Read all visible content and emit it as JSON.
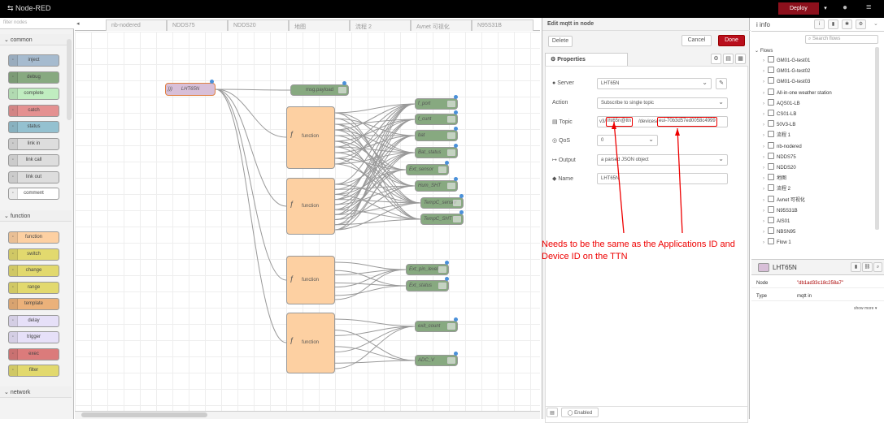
{
  "header": {
    "app_title": "Node-RED",
    "deploy_label": "Deploy"
  },
  "palette": {
    "filter_placeholder": "filter nodes",
    "categories": [
      "common",
      "function",
      "network"
    ],
    "common_nodes": [
      "inject",
      "debug",
      "complete",
      "catch",
      "status",
      "link in",
      "link call",
      "link out",
      "comment"
    ],
    "function_nodes": [
      "function",
      "switch",
      "change",
      "range",
      "template",
      "delay",
      "trigger",
      "exec",
      "filter"
    ]
  },
  "workspace": {
    "tabs": [
      "nb-nodered",
      "NDDS75",
      "NDDS20",
      "地图",
      "流程 2",
      "Avnet 可视化",
      "N95S31B"
    ],
    "flow_nodes": {
      "mqtt_in": "LHT65N",
      "debug_payload": "msg.payload",
      "function": "function",
      "outputs": [
        "f_port",
        "f_cunt",
        "bat",
        "Bat_status",
        "Ext_sensor",
        "Hum_SHT",
        "TempC_sensor",
        "TempC_SHT",
        "Ext_pin_level",
        "Ext_status",
        "exit_count",
        "ADC_V"
      ]
    }
  },
  "editor": {
    "title": "Edit mqtt in node",
    "delete_label": "Delete",
    "cancel_label": "Cancel",
    "done_label": "Done",
    "properties_tab": "Properties",
    "fields": {
      "server_label": "Server",
      "server_value": "LHT65N",
      "action_label": "Action",
      "action_value": "Subscribe to single topic",
      "topic_label": "Topic",
      "topic_prefix": "v3/",
      "topic_app": "lht65n@ttn",
      "topic_mid": "/devices/",
      "topic_dev": "eui-70b3d57ed0058c4999",
      "qos_label": "QoS",
      "qos_value": "0",
      "output_label": "Output",
      "output_value": "a parsed JSON object",
      "name_label": "Name",
      "name_value": "LHT65N"
    },
    "enabled_label": "Enabled",
    "annotation": "Needs to be the same as the Applications ID and Device ID on the TTN",
    "annotation_color": "#e00000"
  },
  "sidebar": {
    "title": "info",
    "search_placeholder": "Search flows",
    "flows_heading": "Flows",
    "flows": [
      "GM01-G-test01",
      "GM01-G-test02",
      "GM01-G-test03",
      "All-in-one weather station",
      "AQS01-LB",
      "CS01-LB",
      "50V3-LB",
      "流程 1",
      "nb-nodered",
      "NDDS75",
      "NDDS20",
      "地图",
      "流程 2",
      "Avnet 可视化",
      "N95S31B",
      "AIS01",
      "NBSN95",
      "Flow 1"
    ],
    "node_title": "LHT65N",
    "node_label": "Node",
    "node_value": "\"db1ad33c18c258a7\"",
    "type_label": "Type",
    "type_value": "mqtt in",
    "show_more": "show more ▾"
  }
}
